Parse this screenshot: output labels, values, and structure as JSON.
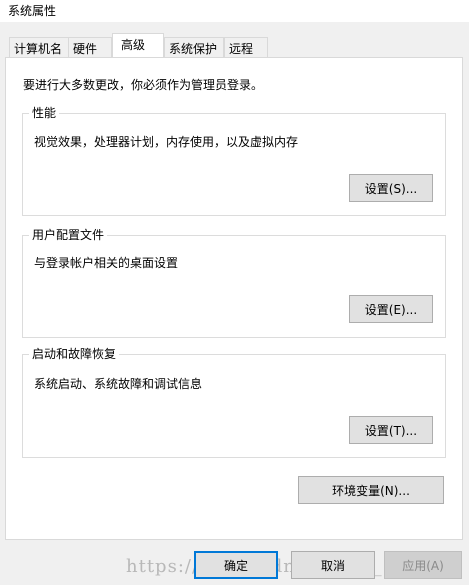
{
  "window": {
    "title": "系统属性"
  },
  "tabs": [
    {
      "label": "计算机名"
    },
    {
      "label": "硬件"
    },
    {
      "label": "高级"
    },
    {
      "label": "系统保护"
    },
    {
      "label": "远程"
    }
  ],
  "notice": "要进行大多数更改，你必须作为管理员登录。",
  "groups": {
    "performance": {
      "title": "性能",
      "desc": "视觉效果，处理器计划，内存使用，以及虚拟内存",
      "button": "设置(S)..."
    },
    "user_profiles": {
      "title": "用户配置文件",
      "desc": "与登录帐户相关的桌面设置",
      "button": "设置(E)..."
    },
    "startup_recovery": {
      "title": "启动和故障恢复",
      "desc": "系统启动、系统故障和调试信息",
      "button": "设置(T)..."
    }
  },
  "env_button": "环境变量(N)...",
  "dialog": {
    "ok": "确定",
    "cancel": "取消",
    "apply": "应用(A)"
  },
  "watermark": "https://blog.csdn.net/m0_37778"
}
